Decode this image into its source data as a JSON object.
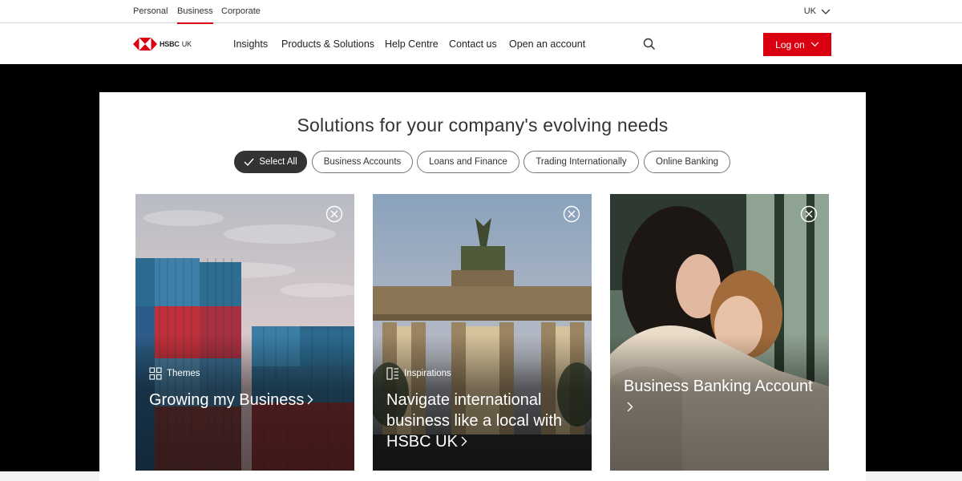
{
  "topbar": {
    "segments": [
      "Personal",
      "Business",
      "Corporate"
    ],
    "region": "UK"
  },
  "header": {
    "logo_brand": "HSBC",
    "logo_region": "UK",
    "nav": [
      "Insights",
      "Products & Solutions",
      "Help Centre",
      "Contact us",
      "Open an account"
    ],
    "search_icon": "search-icon",
    "logon_label": "Log on"
  },
  "main": {
    "title": "Solutions for your company's evolving needs",
    "filters": [
      {
        "label": "Select All",
        "active": true
      },
      {
        "label": "Business Accounts",
        "active": false
      },
      {
        "label": "Loans and Finance",
        "active": false
      },
      {
        "label": "Trading Internationally",
        "active": false
      },
      {
        "label": "Online Banking",
        "active": false
      }
    ],
    "cards": [
      {
        "category": "Themes",
        "category_icon": "grid-icon",
        "title": "Growing my Business"
      },
      {
        "category": "Inspirations",
        "category_icon": "article-icon",
        "title": "Navigate international business like a local with HSBC UK"
      },
      {
        "category": "",
        "title": "Business Banking Account"
      }
    ]
  },
  "colors": {
    "brand_red": "#db0011",
    "dark_text": "#333333",
    "hero_band": "#000000"
  }
}
